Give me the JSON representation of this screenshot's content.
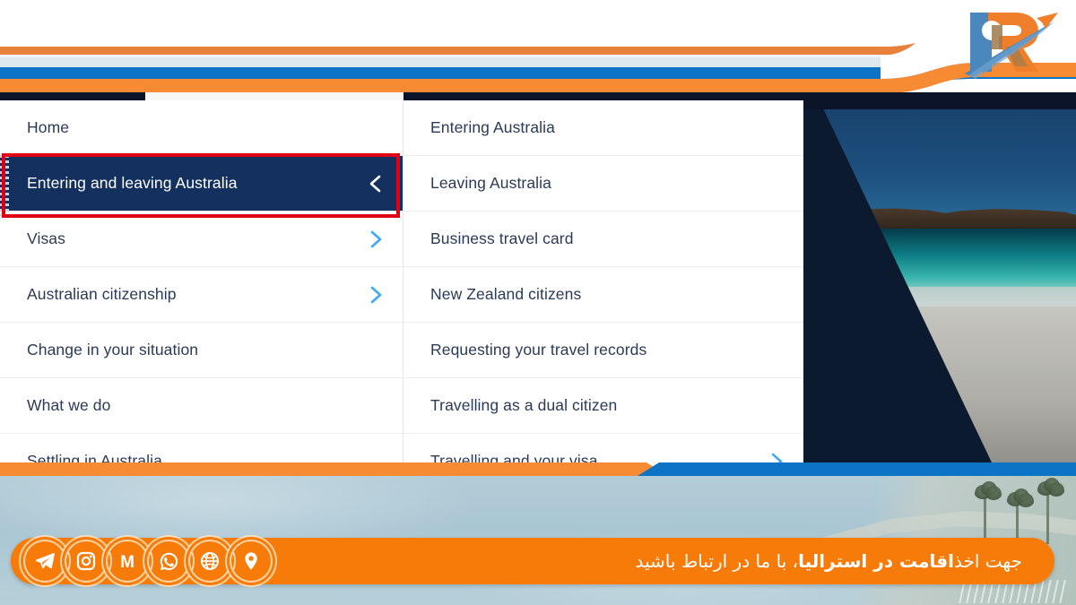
{
  "site": {
    "logo_name": "agency-logo-r-mark",
    "brand_colors": {
      "orange": "#f68b33",
      "blue": "#0d73c4",
      "navy": "#14305e",
      "dark_navy": "#0b1428",
      "cta_orange": "#f77b09",
      "selection_red": "#e00016",
      "chevron_blue": "#3fa9f5"
    }
  },
  "nav": {
    "primary": [
      {
        "label": "Home",
        "has_submenu": false,
        "active": false,
        "chevron": "none"
      },
      {
        "label": "Entering and leaving Australia",
        "has_submenu": true,
        "active": true,
        "chevron": "left"
      },
      {
        "label": "Visas",
        "has_submenu": true,
        "active": false,
        "chevron": "right"
      },
      {
        "label": "Australian citizenship",
        "has_submenu": true,
        "active": false,
        "chevron": "right"
      },
      {
        "label": "Change in your situation",
        "has_submenu": false,
        "active": false,
        "chevron": "none"
      },
      {
        "label": "What we do",
        "has_submenu": false,
        "active": false,
        "chevron": "none"
      },
      {
        "label": "Settling in Australia",
        "has_submenu": false,
        "active": false,
        "chevron": "none"
      }
    ],
    "submenu": [
      {
        "label": "Entering Australia",
        "chevron": "none"
      },
      {
        "label": "Leaving Australia",
        "chevron": "none"
      },
      {
        "label": "Business travel card",
        "chevron": "none"
      },
      {
        "label": "New Zealand citizens",
        "chevron": "none"
      },
      {
        "label": "Requesting your travel records",
        "chevron": "none"
      },
      {
        "label": "Travelling as a dual citizen",
        "chevron": "none"
      },
      {
        "label": "Travelling and your visa",
        "chevron": "right"
      }
    ]
  },
  "hero_photo": {
    "name": "australia-beach-photo",
    "description": "Dark beach and turquoise ocean photograph with diagonal navy overlay"
  },
  "cta": {
    "text_plain_lead": "جهت اخذ ",
    "text_bold": "اقامت در استرالیا",
    "text_plain_tail": "، با ما در ارتباط باشید",
    "socials": [
      {
        "name": "telegram-icon",
        "glyph": "telegram"
      },
      {
        "name": "instagram-icon",
        "glyph": "instagram"
      },
      {
        "name": "mail-icon",
        "glyph": "M"
      },
      {
        "name": "whatsapp-icon",
        "glyph": "whatsapp"
      },
      {
        "name": "website-globe-icon",
        "glyph": "globe"
      },
      {
        "name": "location-pin-icon",
        "glyph": "pin"
      }
    ]
  },
  "annotation": {
    "selection_target": "Entering and leaving Australia",
    "box_color": "#e00016"
  }
}
